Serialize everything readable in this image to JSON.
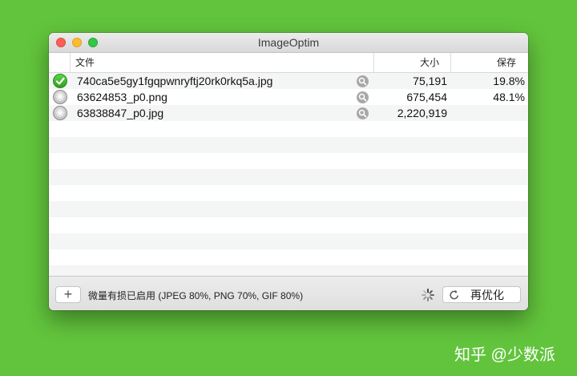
{
  "window": {
    "title": "ImageOptim"
  },
  "columns": {
    "file": "文件",
    "size": "大小",
    "savings": "保存"
  },
  "files": [
    {
      "status": "done",
      "status_icon": "checkmark-icon",
      "name": "740ca5e5gy1fgqpwnryftj20rk0rkq5a.jpg",
      "size": "75,191",
      "savings": "19.8%"
    },
    {
      "status": "waiting",
      "status_icon": "waiting-icon",
      "name": "63624853_p0.png",
      "size": "675,454",
      "savings": "48.1%"
    },
    {
      "status": "waiting",
      "status_icon": "waiting-icon",
      "name": "63838847_p0.jpg",
      "size": "2,220,919",
      "savings": ""
    }
  ],
  "toolbar": {
    "add_label": "+",
    "status_text": "微量有损已启用 (JPEG 80%, PNG 70%, GIF 80%)",
    "reoptimize_label": "再优化"
  },
  "watermark": {
    "text": "知乎 @少数派"
  },
  "colors": {
    "background": "#62c43c",
    "close": "#fc5f57",
    "minimize": "#fdbc2e",
    "zoom": "#33c748",
    "done": "#3ab52a"
  }
}
